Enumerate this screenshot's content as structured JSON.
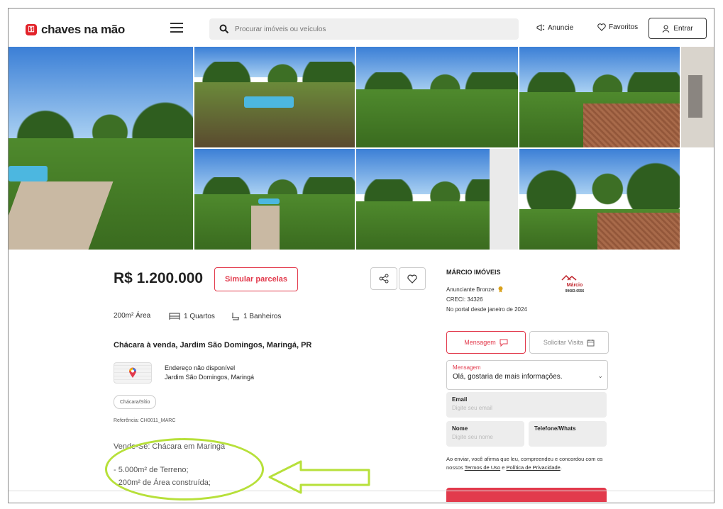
{
  "header": {
    "logo_text": "chaves na mão",
    "search_placeholder": "Procurar imóveis ou veículos",
    "anuncie": "Anuncie",
    "favoritos": "Favoritos",
    "entrar": "Entrar"
  },
  "listing": {
    "price": "R$ 1.200.000",
    "simular_label": "Simular parcelas",
    "area": "200m² Área",
    "quartos": "1 Quartos",
    "banheiros": "1 Banheiros",
    "title": "Chácara à venda, Jardim São Domingos, Maringá, PR",
    "address_line1": "Endereço não disponível",
    "address_line2": "Jardim São Domingos, Maringá",
    "tag": "Chácara/Sítio",
    "reference": "Referência: CH0011_MARC",
    "desc_line1": "Vende-Se: Chácara em Maringá",
    "desc_line2": "- 5.000m² de Terreno;",
    "desc_line3": "- 200m² de Área construída;"
  },
  "agent": {
    "name": "MÁRCIO IMÓVEIS",
    "tier": "Anunciante Bronze",
    "creci": "CRECI: 34326",
    "since": "No portal desde janeiro de 2024",
    "logo_line1": "Márcio",
    "logo_line2": "99683-6556"
  },
  "contact": {
    "tab_message": "Mensagem",
    "tab_visit": "Solicitar Visita",
    "message_label": "Mensagem",
    "message_value": "Olá, gostaria de mais informações.",
    "email_label": "Email",
    "email_placeholder": "Digite seu email",
    "name_label": "Nome",
    "name_placeholder": "Digite seu nome",
    "phone_label": "Telefone/Whats",
    "legal_prefix": "Ao enviar, você afirma que leu, compreendeu e concordou com os nossos",
    "terms": "Termos de Uso",
    "and": "e",
    "privacy": "Política de Privacidade"
  },
  "colors": {
    "brand_red": "#e23a4c",
    "annotation_green": "#b7e03a"
  }
}
